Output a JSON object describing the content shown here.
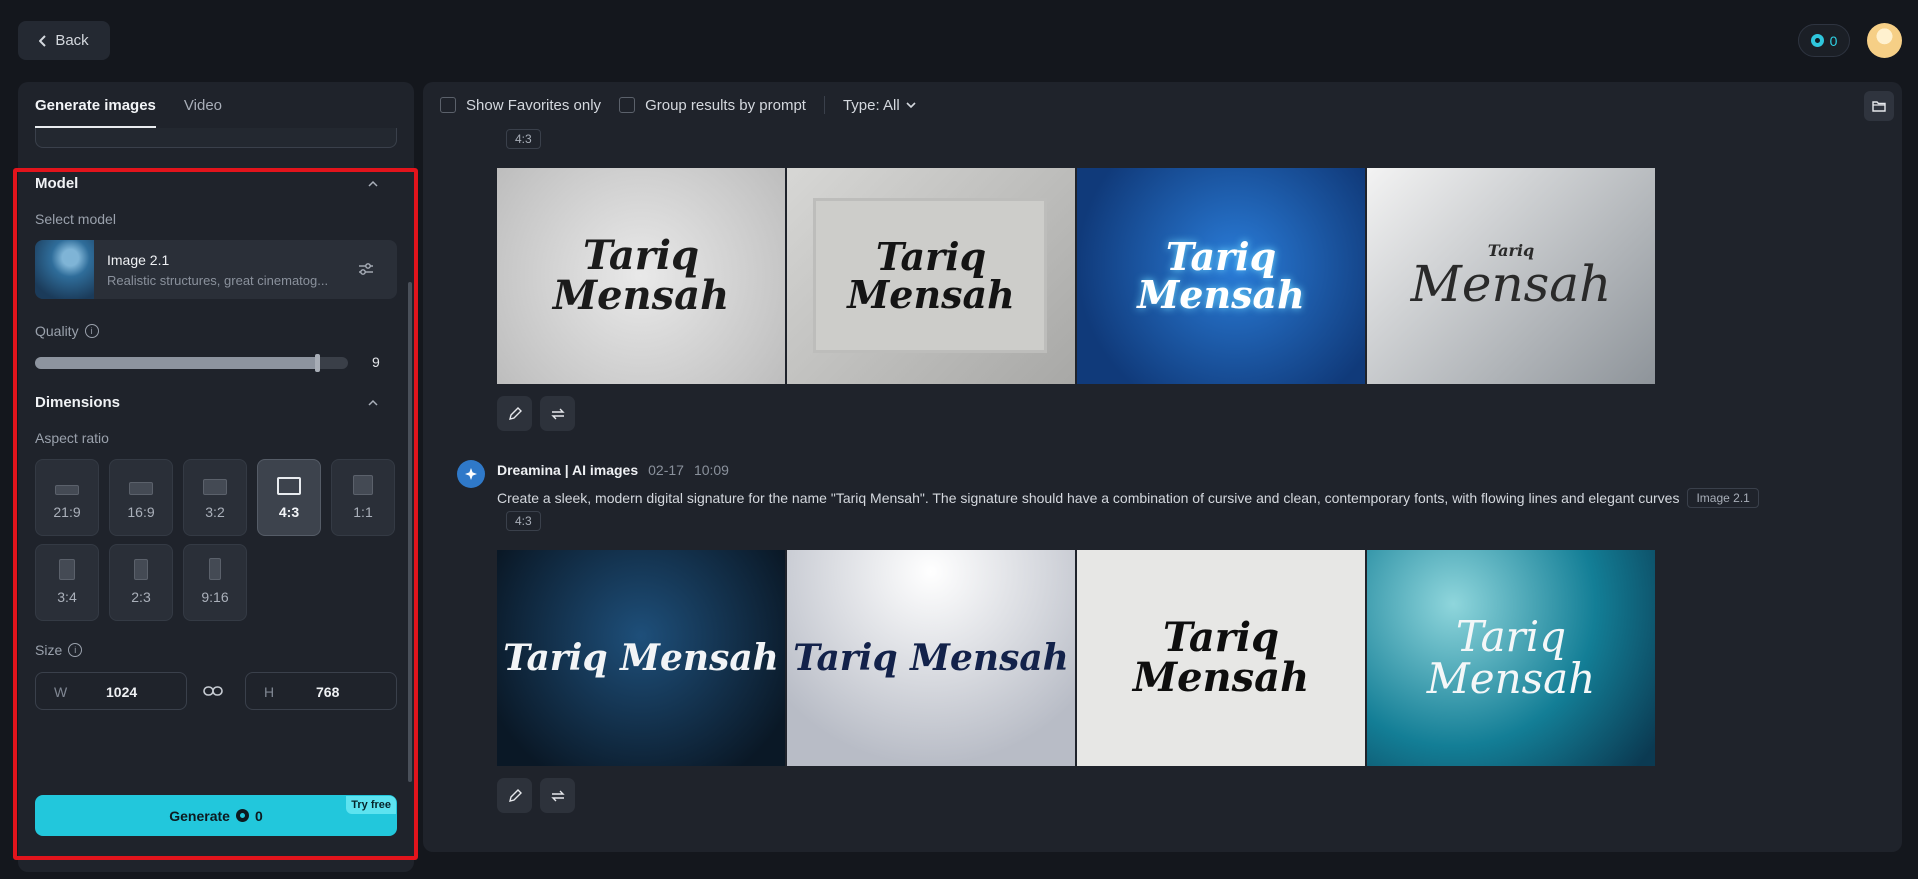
{
  "topbar": {
    "back_label": "Back",
    "credits": "0"
  },
  "left": {
    "tabs": [
      {
        "label": "Generate images"
      },
      {
        "label": "Video"
      }
    ],
    "model": {
      "section_title": "Model",
      "select_label": "Select model",
      "name": "Image 2.1",
      "description": "Realistic structures, great cinematog..."
    },
    "quality": {
      "label": "Quality",
      "value": "9",
      "level": 0.9
    },
    "dimensions": {
      "section_title": "Dimensions",
      "aspect_label": "Aspect ratio",
      "ratios": [
        "21:9",
        "16:9",
        "3:2",
        "4:3",
        "1:1",
        "3:4",
        "2:3",
        "9:16"
      ],
      "selected": "4:3"
    },
    "size": {
      "label": "Size",
      "w_prefix": "W",
      "w_value": "1024",
      "h_prefix": "H",
      "h_value": "768"
    },
    "generate": {
      "label": "Generate",
      "cost": "0",
      "badge": "Try free"
    }
  },
  "right": {
    "filters": {
      "favorites": "Show Favorites only",
      "group": "Group results by prompt",
      "type": "Type: All"
    },
    "groups": [
      {
        "ratio_tag": "4:3",
        "images": [
          {
            "text_line1": "Tariq",
            "text_line2": "Mensah"
          },
          {
            "text_line1": "Tariq Mensah",
            "text_line2": ""
          },
          {
            "text_line1": "Tariq Mensah",
            "text_line2": ""
          },
          {
            "text_line1": "Tariq",
            "text_line2": "Mensah"
          }
        ]
      },
      {
        "author": "Dreamina | AI images",
        "date": "02-17",
        "time": "10:09",
        "prompt": "Create a sleek, modern digital signature for the name \"Tariq Mensah\". The signature should have a combination of cursive and clean, contemporary fonts, with flowing lines and elegant curves",
        "model_tag": "Image 2.1",
        "ratio_tag": "4:3",
        "images": [
          {
            "text_line1": "Tariq Mensah",
            "text_line2": ""
          },
          {
            "text_line1": "Tariq Mensah",
            "text_line2": ""
          },
          {
            "text_line1": "Tariq",
            "text_line2": "Mensah"
          },
          {
            "text_line1": "Tariq",
            "text_line2": "Mensah"
          }
        ]
      }
    ]
  }
}
